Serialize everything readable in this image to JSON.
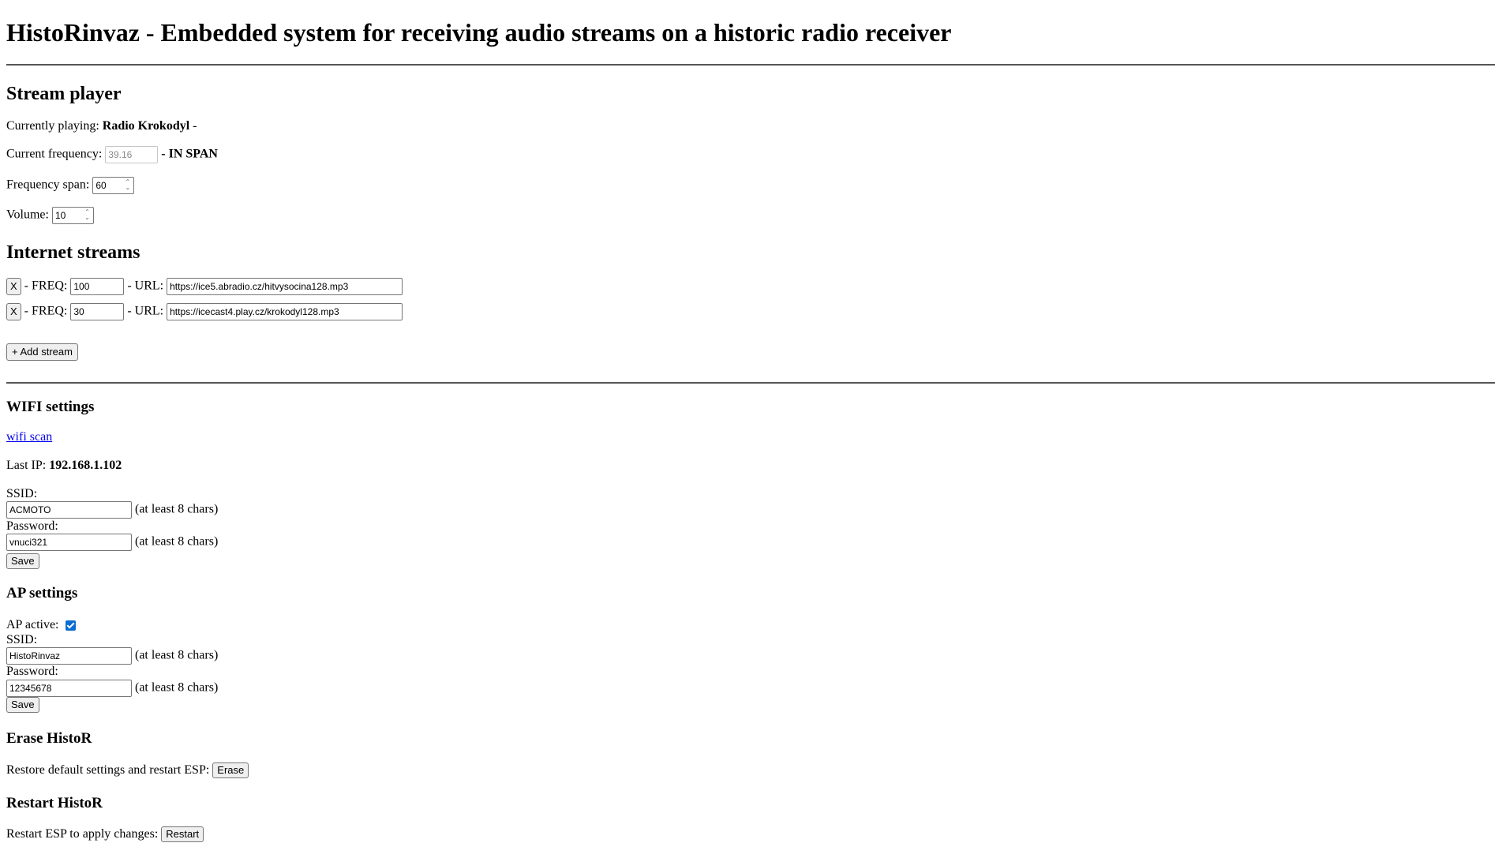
{
  "title": "HistoRinvaz - Embedded system for receiving audio streams on a historic radio receiver",
  "stream_player": {
    "heading": "Stream player",
    "currently_playing_label": "Currently playing:",
    "currently_playing_value": "Radio Krokodyl",
    "currently_playing_suffix": "-",
    "current_frequency_label": "Current frequency:",
    "current_frequency_value": "39.16",
    "frequency_status": "- IN SPAN",
    "frequency_span_label": "Frequency span:",
    "frequency_span_value": "60",
    "volume_label": "Volume:",
    "volume_value": "10"
  },
  "internet_streams": {
    "heading": "Internet streams",
    "remove_label": "X",
    "freq_label": "- FREQ:",
    "url_label": "- URL:",
    "streams": [
      {
        "freq": "100",
        "url": "https://ice5.abradio.cz/hitvysocina128.mp3"
      },
      {
        "freq": "30",
        "url": "https://icecast4.play.cz/krokodyl128.mp3"
      }
    ],
    "add_label": "+ Add stream"
  },
  "wifi": {
    "heading": "WIFI settings",
    "scan_link": "wifi scan",
    "last_ip_label": "Last IP:",
    "last_ip_value": "192.168.1.102",
    "ssid_label": "SSID:",
    "ssid_value": "ACMOTO",
    "ssid_hint": "(at least 8 chars)",
    "password_label": "Password:",
    "password_value": "vnuci321",
    "password_hint": "(at least 8 chars)",
    "save_label": "Save"
  },
  "ap": {
    "heading": "AP settings",
    "active_label": "AP active:",
    "active": true,
    "ssid_label": "SSID:",
    "ssid_value": "HistoRinvaz",
    "ssid_hint": "(at least 8 chars)",
    "password_label": "Password:",
    "password_value": "12345678",
    "password_hint": "(at least 8 chars)",
    "save_label": "Save"
  },
  "erase": {
    "heading": "Erase HistoR",
    "text": "Restore default settings and restart ESP:",
    "button": "Erase"
  },
  "restart": {
    "heading": "Restart HistoR",
    "text": "Restart ESP to apply changes:",
    "button": "Restart"
  }
}
